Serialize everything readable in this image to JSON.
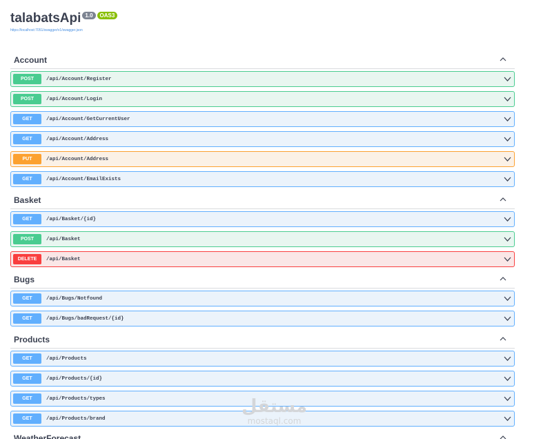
{
  "info": {
    "title": "talabatsApi",
    "version": "1.0",
    "oas": "OAS3",
    "spec_url": "https://localhost:7051/swagger/v1/swagger.json"
  },
  "colors": {
    "get": "#61affe",
    "post": "#49cc90",
    "put": "#fca130",
    "delete": "#f93e3e"
  },
  "tags": [
    {
      "name": "Account",
      "operations": [
        {
          "method": "POST",
          "path": "/api/Account/Register"
        },
        {
          "method": "POST",
          "path": "/api/Account/Login"
        },
        {
          "method": "GET",
          "path": "/api/Account/GetCurrentUser"
        },
        {
          "method": "GET",
          "path": "/api/Account/Address"
        },
        {
          "method": "PUT",
          "path": "/api/Account/Address"
        },
        {
          "method": "GET",
          "path": "/api/Account/EmailExists"
        }
      ]
    },
    {
      "name": "Basket",
      "operations": [
        {
          "method": "GET",
          "path": "/api/Basket/{id}"
        },
        {
          "method": "POST",
          "path": "/api/Basket"
        },
        {
          "method": "DELETE",
          "path": "/api/Basket"
        }
      ]
    },
    {
      "name": "Bugs",
      "operations": [
        {
          "method": "GET",
          "path": "/api/Bugs/Notfound"
        },
        {
          "method": "GET",
          "path": "/api/Bugs/badRequest/{id}"
        }
      ]
    },
    {
      "name": "Products",
      "operations": [
        {
          "method": "GET",
          "path": "/api/Products"
        },
        {
          "method": "GET",
          "path": "/api/Products/{id}"
        },
        {
          "method": "GET",
          "path": "/api/Products/types"
        },
        {
          "method": "GET",
          "path": "/api/Products/brand"
        }
      ]
    },
    {
      "name": "WeatherForecast",
      "operations": []
    }
  ],
  "watermark": {
    "arabic": "مستقل",
    "latin": "mostaql.com"
  }
}
